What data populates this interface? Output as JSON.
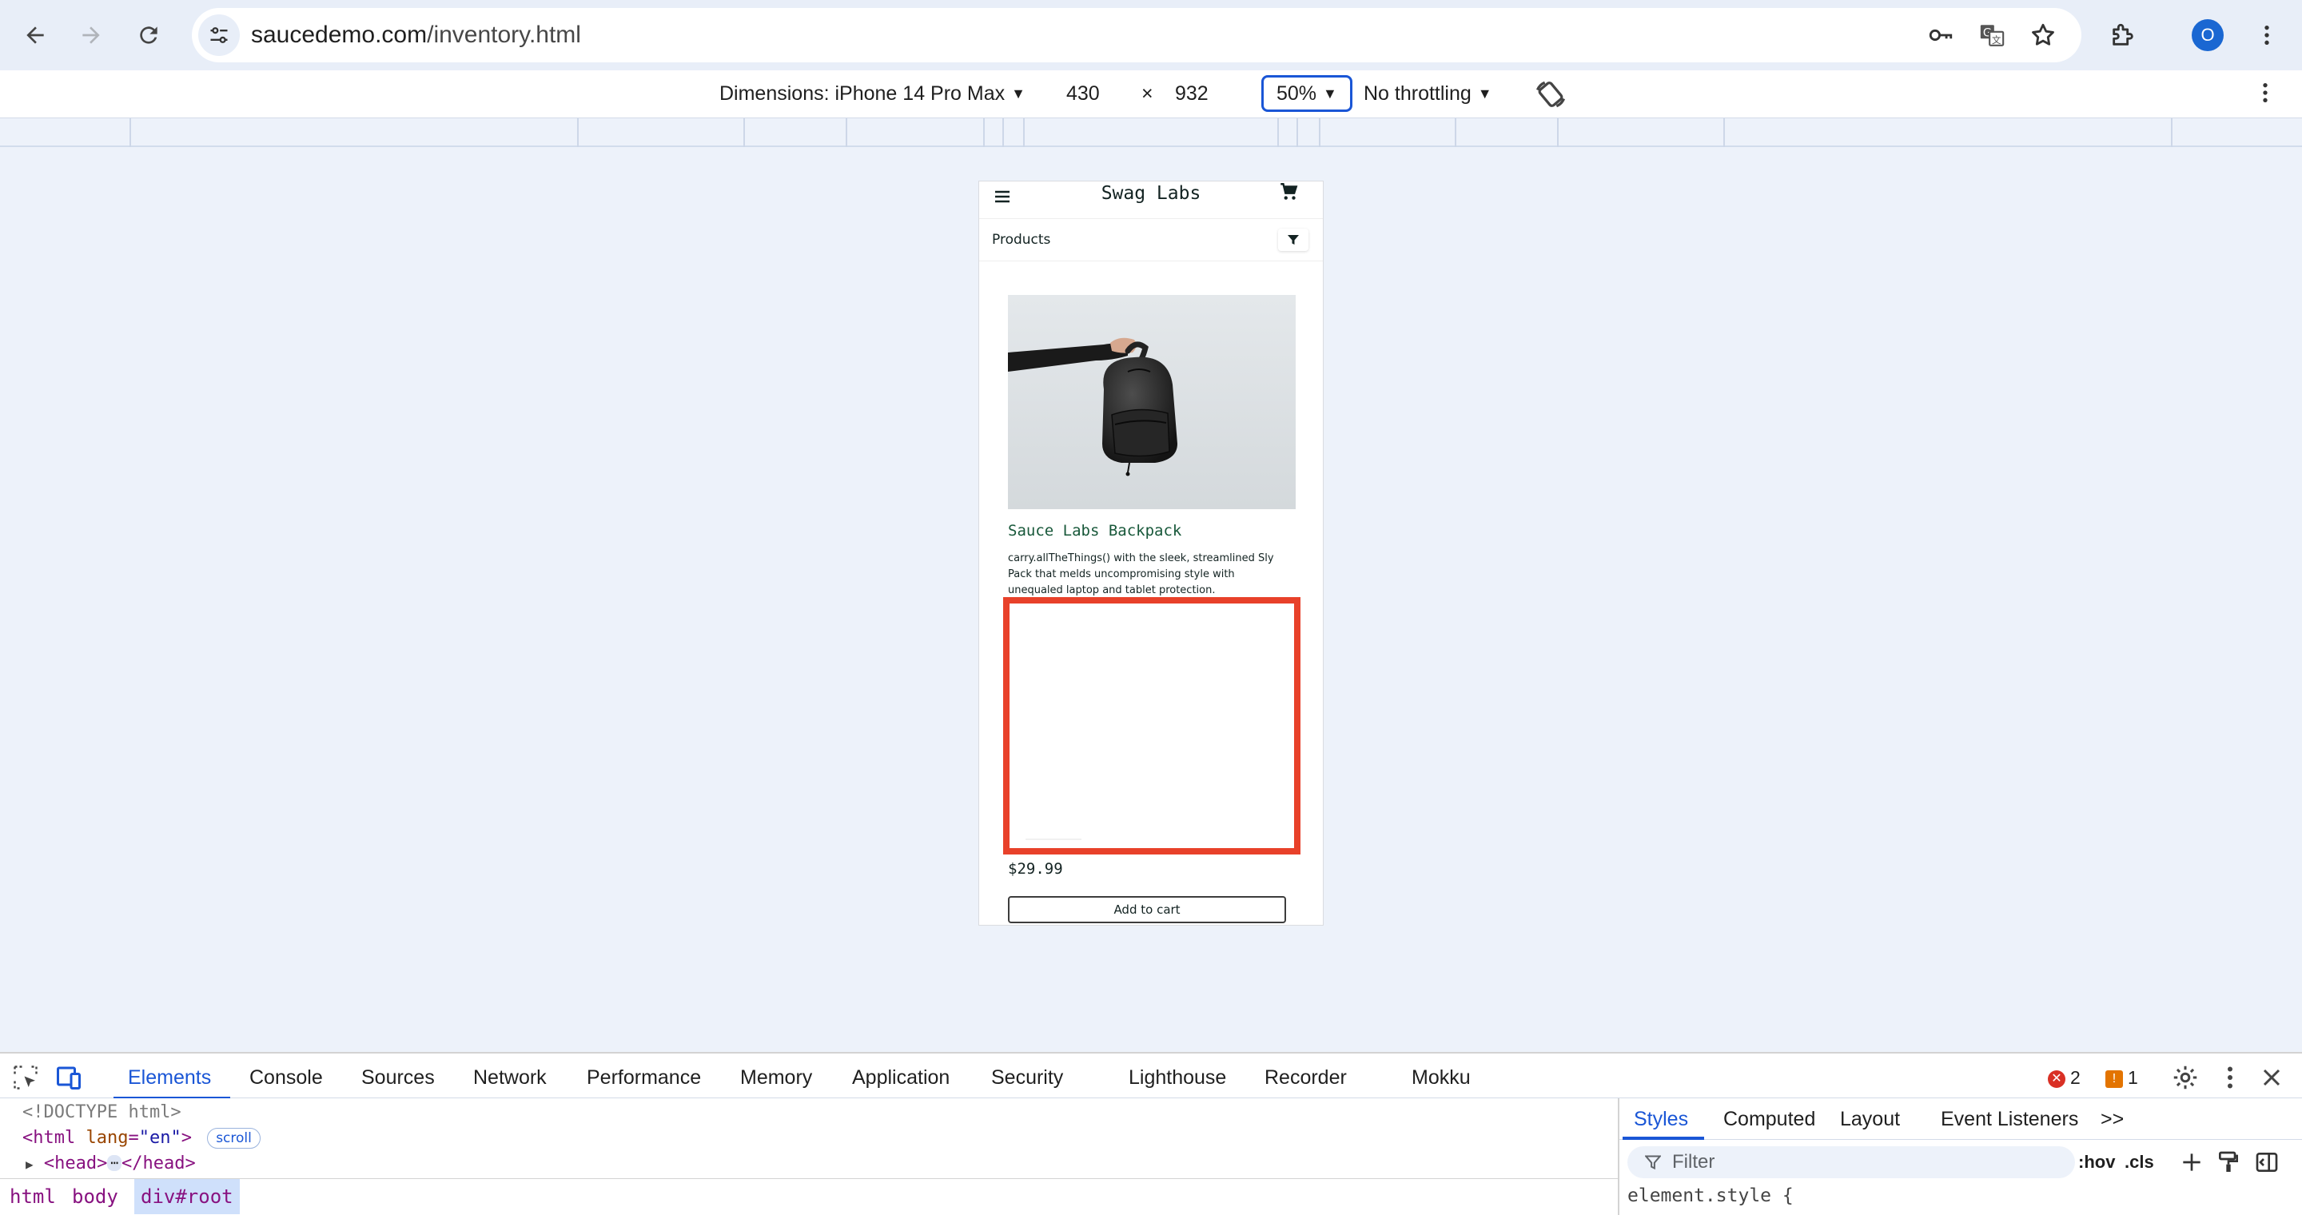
{
  "browser": {
    "url_host": "saucedemo.com",
    "url_path": "/inventory.html",
    "profile_initial": "O"
  },
  "device_toolbar": {
    "dimensions_label": "Dimensions: iPhone 14 Pro Max",
    "width": "430",
    "times": "×",
    "height": "932",
    "zoom": "50%",
    "throttling": "No throttling"
  },
  "app": {
    "logo": "Swag Labs",
    "page_title": "Products",
    "product": {
      "name": "Sauce Labs Backpack",
      "description": "carry.allTheThings() with the sleek, streamlined Sly Pack that melds uncompromising style with unequaled laptop and tablet protection.",
      "price": "$29.99",
      "button": "Add to cart"
    }
  },
  "devtools": {
    "tabs": [
      "Elements",
      "Console",
      "Sources",
      "Network",
      "Performance",
      "Memory",
      "Application",
      "Security",
      "Lighthouse",
      "Recorder",
      "Mokku"
    ],
    "errors": "2",
    "warnings": "1",
    "code": {
      "doctype": "<!DOCTYPE html>",
      "html_open": "<html",
      "lang_attr": "lang",
      "lang_val": "\"en\"",
      "html_close_bracket": ">",
      "scroll_chip": "scroll",
      "head_open": "<head>",
      "ellipsis": "⋯",
      "head_close": "</head>"
    },
    "breadcrumbs": [
      "html",
      "body",
      "div#root"
    ],
    "styles_tabs": [
      "Styles",
      "Computed",
      "Layout",
      "Event Listeners"
    ],
    "more": ">>",
    "filter_placeholder": "Filter",
    "hov": ":hov",
    "cls": ".cls",
    "element_style": "element.style {"
  },
  "colors": {
    "accent": "#1a56d6",
    "highlight_box": "#e8412a",
    "product_name": "#18583a",
    "viewport_bg": "#edf2fa"
  }
}
